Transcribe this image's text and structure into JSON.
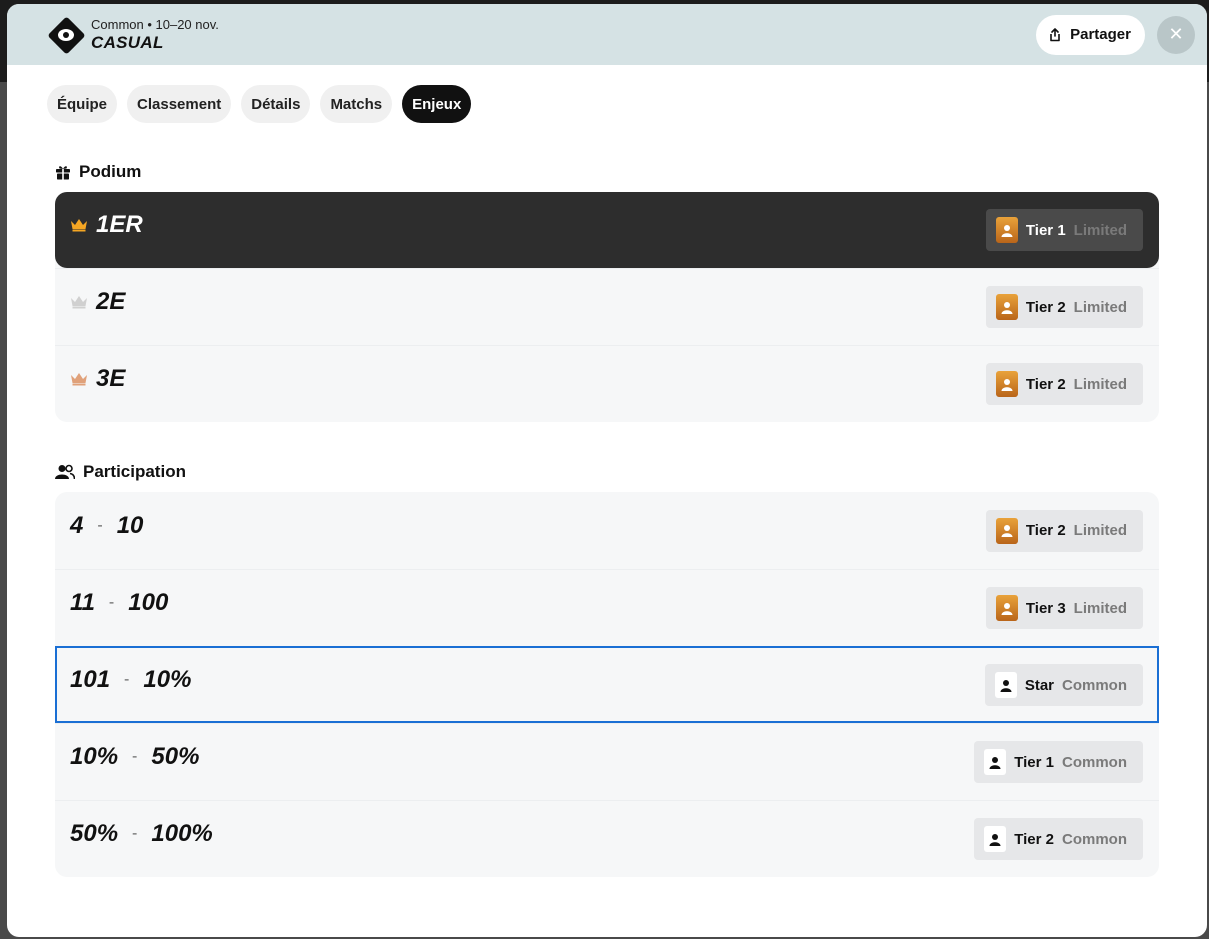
{
  "header": {
    "subtitle": "Common • 10–20 nov.",
    "title": "CASUAL",
    "share_label": "Partager",
    "close_label": "✕"
  },
  "tabs": [
    {
      "label": "Équipe",
      "active": false
    },
    {
      "label": "Classement",
      "active": false
    },
    {
      "label": "Détails",
      "active": false
    },
    {
      "label": "Matchs",
      "active": false
    },
    {
      "label": "Enjeux",
      "active": true
    }
  ],
  "podium": {
    "title": "Podium",
    "icon": "gift-icon",
    "rows": [
      {
        "rank": "1ER",
        "crown": "gold",
        "tier": "Tier 1",
        "rarity": "Limited"
      },
      {
        "rank": "2E",
        "crown": "silver",
        "tier": "Tier 2",
        "rarity": "Limited"
      },
      {
        "rank": "3E",
        "crown": "bronze",
        "tier": "Tier 2",
        "rarity": "Limited"
      }
    ]
  },
  "participation": {
    "title": "Participation",
    "icon": "users-icon",
    "rows": [
      {
        "from": "4",
        "to": "10",
        "tier": "Tier 2",
        "rarity": "Limited"
      },
      {
        "from": "11",
        "to": "100",
        "tier": "Tier 3",
        "rarity": "Limited"
      },
      {
        "from": "101",
        "to": "10%",
        "tier": "Star",
        "rarity": "Common"
      },
      {
        "from": "10%",
        "to": "50%",
        "tier": "Tier 1",
        "rarity": "Common"
      },
      {
        "from": "50%",
        "to": "100%",
        "tier": "Tier 2",
        "rarity": "Common"
      }
    ],
    "dash": "-"
  },
  "colors": {
    "header_bg": "#d5e2e4",
    "gold": "#f5a623",
    "silver": "#d0d0d0",
    "bronze": "#e0a17a",
    "highlight": "#1a6fd4"
  }
}
